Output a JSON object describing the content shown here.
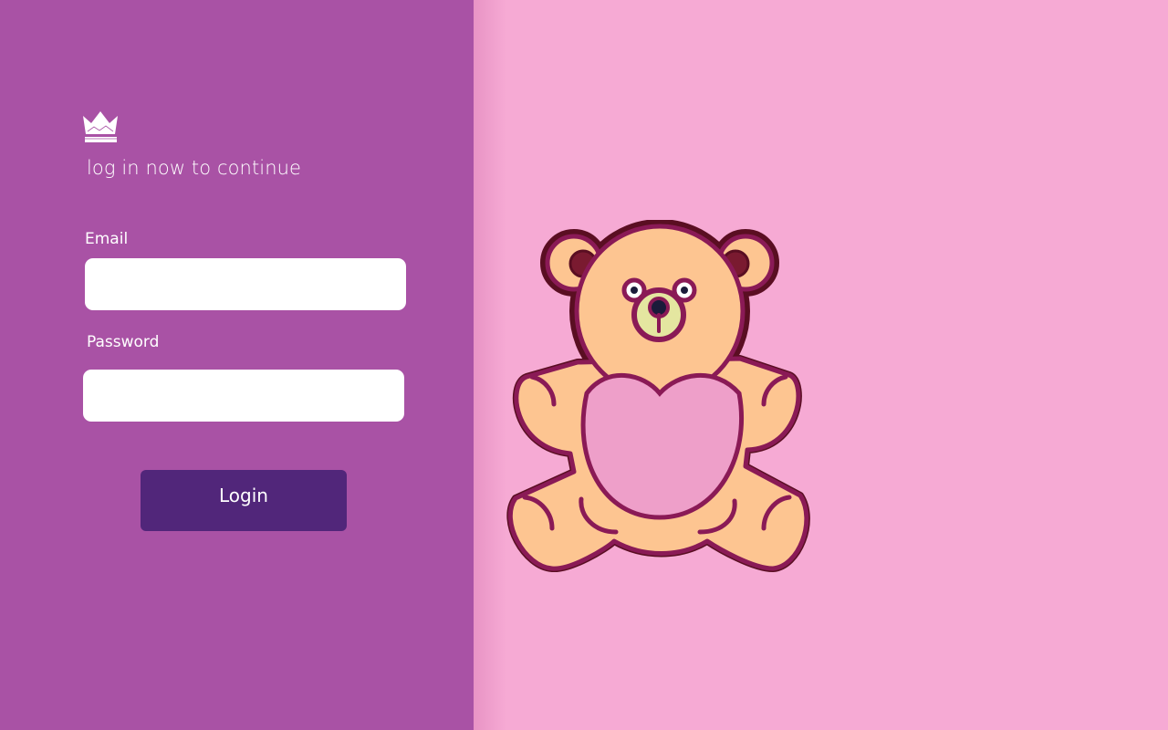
{
  "login": {
    "subtitle": "log in now to continue",
    "email_label": "Email",
    "email_value": "",
    "password_label": "Password",
    "password_value": "",
    "button_label": "Login"
  },
  "logo": {
    "icon": "crown-icon"
  },
  "illustration": {
    "icon": "teddy-bear-icon"
  },
  "colors": {
    "left_panel": "#a952a5",
    "right_panel": "#f6aad4",
    "button": "#51267a",
    "bear_fur": "#fdc591",
    "bear_belly": "#ee9fc9",
    "bear_outline": "#8a1a56"
  }
}
